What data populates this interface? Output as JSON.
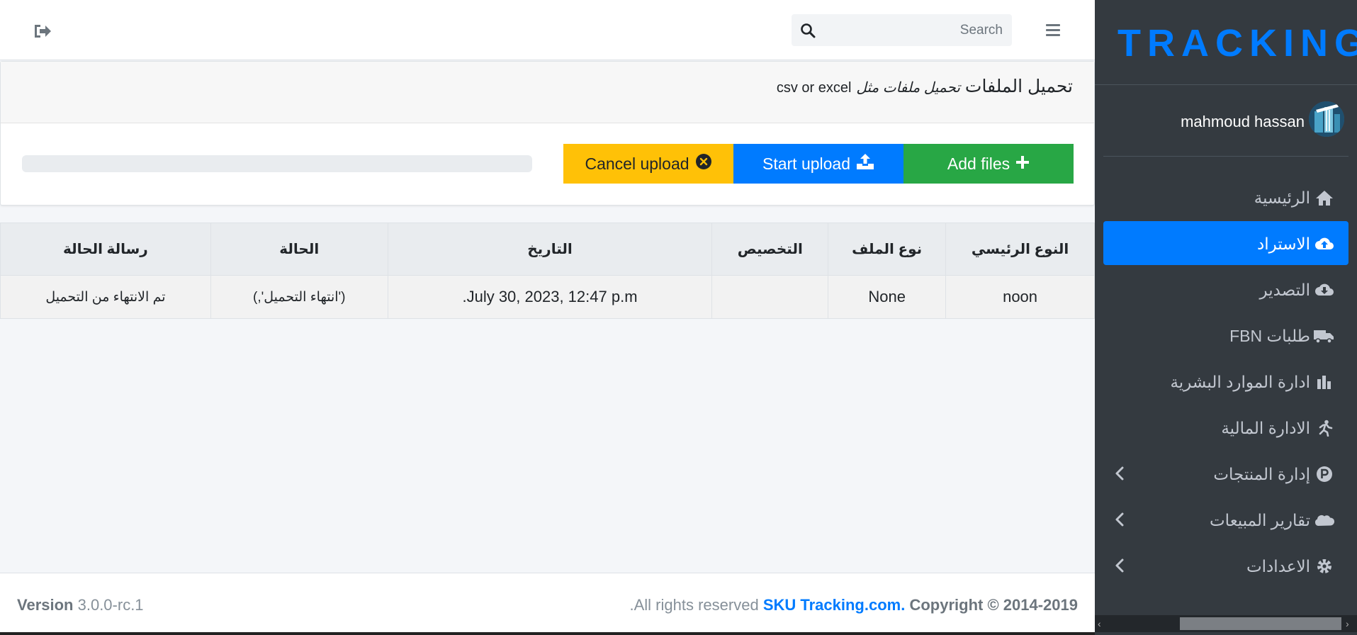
{
  "navbar": {
    "search_placeholder": "Search"
  },
  "upload_card": {
    "title": "تحميل الملفات",
    "subtitle": "تحميل ملفات مثل",
    "formats": "csv or excel",
    "add_files_label": "Add files",
    "start_upload_label": "Start upload",
    "cancel_upload_label": "Cancel upload",
    "progress_percent": 0
  },
  "table": {
    "headers": [
      "النوع الرئيسي",
      "نوع الملف",
      "التخصيص",
      "التاريخ",
      "الحالة",
      "رسالة الحالة"
    ],
    "rows": [
      [
        "noon",
        "None",
        "",
        "July 30, 2023, 12:47 p.m.",
        "('انتهاء التحميل',)",
        "تم الانتهاء من التحميل"
      ]
    ]
  },
  "footer": {
    "version_label": "Version",
    "version_value": "3.0.0-rc.1",
    "copyright_prefix": "Copyright © 2014-2019",
    "brand": "SKU Tracking.com.",
    "rights": "All rights reserved."
  },
  "sidebar": {
    "brand": "TRACKING",
    "user_name": "mahmoud hassan",
    "items": [
      {
        "label": "الرئيسية",
        "icon": "home-icon"
      },
      {
        "label": "الاستراد",
        "icon": "cloud-upload-icon"
      },
      {
        "label": "التصدير",
        "icon": "cloud-download-icon"
      },
      {
        "label": "طلبات FBN",
        "icon": "truck-icon"
      },
      {
        "label": "ادارة الموارد البشرية",
        "icon": "bar-chart-icon"
      },
      {
        "label": "الادارة المالية",
        "icon": "running-icon"
      },
      {
        "label": "إدارة المنتجات",
        "icon": "parking-icon"
      },
      {
        "label": "تقارير المبيعات",
        "icon": "salesforce-icon"
      },
      {
        "label": "الاعدادات",
        "icon": "gear-icon"
      }
    ]
  },
  "colors": {
    "primary": "#007bff",
    "success": "#28a745",
    "warning": "#ffc107",
    "sidebar_bg": "#343a40"
  }
}
